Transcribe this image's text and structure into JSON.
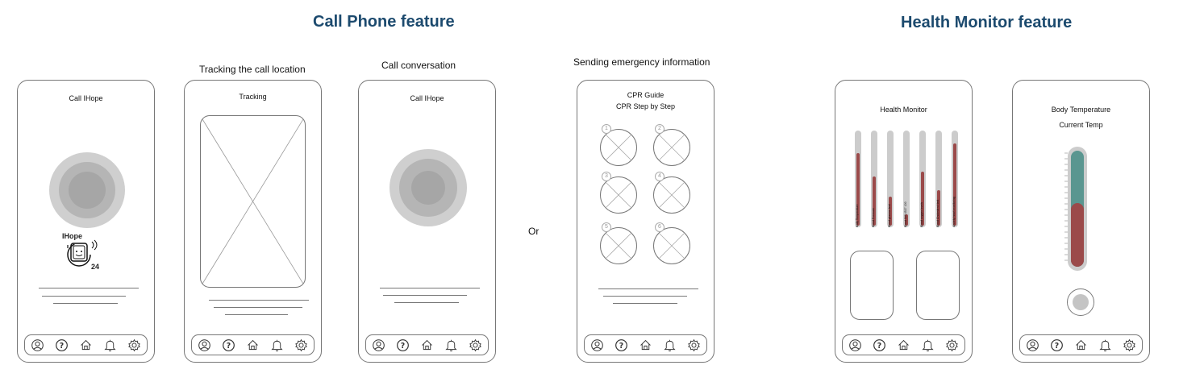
{
  "sections": {
    "call_phone": "Call Phone feature",
    "health_monitor": "Health Monitor feature"
  },
  "captions": {
    "tracking": "Tracking the call location",
    "conversation": "Call conversation",
    "emergency": "Sending emergency information",
    "or": "Or"
  },
  "screens": {
    "call": {
      "title": "Call IHope",
      "logo_text": "IHope",
      "logo_num": "24"
    },
    "tracking": {
      "title": "Tracking"
    },
    "conversation": {
      "title": "Call IHope"
    },
    "cpr": {
      "title": "CPR Guide",
      "subtitle": "CPR Step by Step",
      "steps": [
        "1",
        "2",
        "3",
        "4",
        "5",
        "6"
      ]
    },
    "health": {
      "title": "Health Monitor",
      "metrics": [
        {
          "label": "Body Temperature",
          "level": 0.78
        },
        {
          "label": "Blood Pressure",
          "level": 0.53
        },
        {
          "label": "Blood glucose test",
          "level": 0.31
        },
        {
          "label": "Blood 500-4527 100",
          "level": 0.12
        },
        {
          "label": "Blood oxygen levels",
          "level": 0.58
        },
        {
          "label": "Blood Cholesterol test",
          "level": 0.38
        },
        {
          "label": "Anxiety heart monitoring",
          "level": 0.88
        }
      ]
    },
    "temperature": {
      "title": "Body Temperature",
      "subtitle": "Current Temp",
      "level": 0.55
    }
  },
  "nav": [
    "profile-icon",
    "help-icon",
    "home-icon",
    "bell-icon",
    "settings-icon"
  ],
  "colors": {
    "title": "#1c4a6e",
    "fill_red": "#9b4a4a",
    "fill_teal": "#5a9690"
  }
}
